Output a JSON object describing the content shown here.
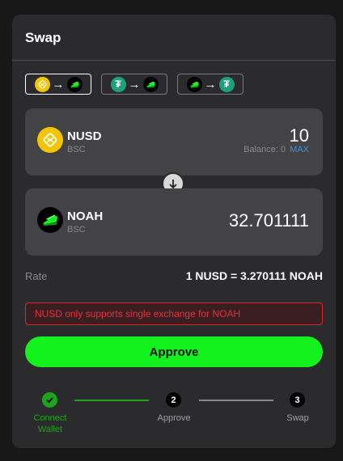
{
  "title": "Swap",
  "pairs": [
    {
      "from_icon": "nusd-coin-icon",
      "to_icon": "noah-coin-icon",
      "active": true
    },
    {
      "from_icon": "usdt-coin-icon",
      "to_icon": "noah-coin-icon",
      "active": false
    },
    {
      "from_icon": "noah-coin-icon",
      "to_icon": "usdt-coin-icon",
      "active": false
    }
  ],
  "pair_arrow": "→",
  "from": {
    "symbol": "NUSD",
    "network": "BSC",
    "amount": "10",
    "balance_label": "Balance: 0",
    "max_label": "MAX"
  },
  "to": {
    "symbol": "NOAH",
    "network": "BSC",
    "amount": "32.701111"
  },
  "rate": {
    "label": "Rate",
    "value": "1 NUSD = 3.270111 NOAH"
  },
  "error_message": "NUSD only supports single exchange for NOAH",
  "approve_label": "Approve",
  "steps": [
    {
      "label_line1": "Connect",
      "label_line2": "Wallet",
      "status": "done"
    },
    {
      "number": "2",
      "label": "Approve",
      "status": "pending"
    },
    {
      "number": "3",
      "label": "Swap",
      "status": "pending"
    }
  ],
  "colors": {
    "accent_green": "#14f21e",
    "step_done": "#1ea41b",
    "error": "#e8313a",
    "link_blue": "#3d8fe0",
    "nusd_yellow": "#f5c400",
    "usdt_teal": "#1aa37a"
  }
}
